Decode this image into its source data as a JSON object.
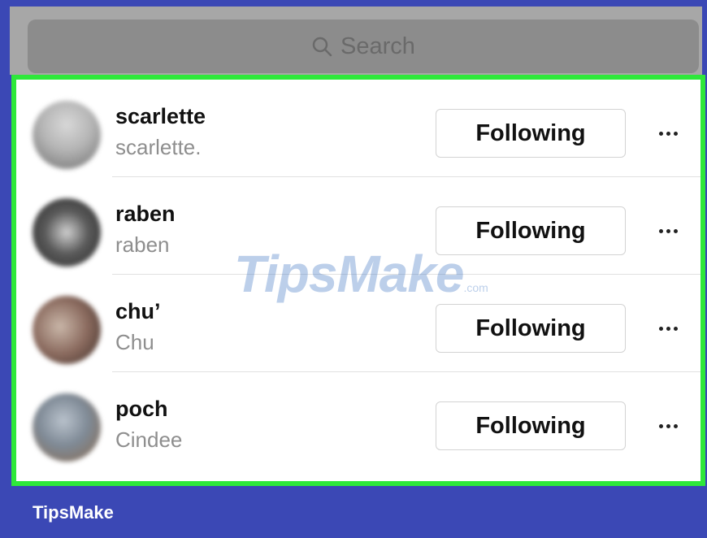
{
  "search": {
    "placeholder": "Search",
    "icon": "search-icon"
  },
  "following_list": [
    {
      "username": "scarlette",
      "full_name": "scarlette.",
      "button_label": "Following",
      "avatar_color": "#9c9c9c"
    },
    {
      "username": "raben",
      "full_name": "raben",
      "button_label": "Following",
      "avatar_color": "#4a4a4a"
    },
    {
      "username": "chu’",
      "full_name": "Chu",
      "button_label": "Following",
      "avatar_color": "#8a6a5e"
    },
    {
      "username": "poch",
      "full_name": "Cindee",
      "button_label": "Following",
      "avatar_color": "#7f8a96"
    }
  ],
  "watermark": {
    "text": "TipsMake",
    "suffix": ".com"
  },
  "footer": {
    "brand": "TipsMake"
  },
  "colors": {
    "frame": "#3b48b5",
    "highlight_border": "#2ee83a",
    "search_bg": "#8c8c8c"
  }
}
